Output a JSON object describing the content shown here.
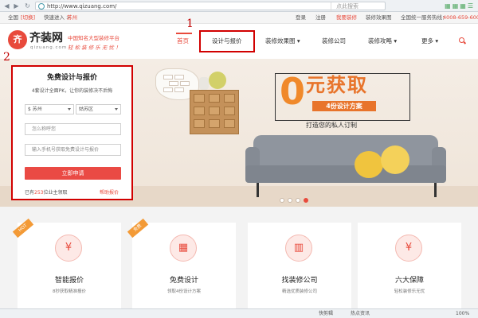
{
  "browser": {
    "url": "http://www.qizuang.com/",
    "search_placeholder": "点此搜索",
    "nav_icons": [
      "back-icon",
      "forward-icon",
      "refresh-icon",
      "home-icon"
    ]
  },
  "topbar": {
    "region": "全国",
    "switch": "[切换]",
    "quick_enter": "快速进入 >",
    "city": "苏州",
    "login": "登录",
    "register": "注册",
    "want_decorate": "我要装修",
    "pricing_link": "装修效果图",
    "hotline_label": "全国统一服务热线：",
    "hotline": "4008-659-600"
  },
  "header": {
    "logo_mark": "齐",
    "logo_name": "齐装网",
    "logo_sub": "qizuang.com",
    "slogan_line1": "中国知名大型装修平台",
    "slogan_line2": "轻 松 装 修 乐 无 忧 ！",
    "nav": {
      "home": "首页",
      "design_quote": "设计与报价",
      "effects": "装修效果图",
      "company": "装修公司",
      "guide": "装修攻略",
      "more": "更多"
    }
  },
  "annotations": {
    "label_1": "1",
    "label_2": "2"
  },
  "hero": {
    "zero": "0",
    "huoqu": "元获取",
    "strip": "4份设计方案",
    "subtitle": "打造您的私人订制"
  },
  "form": {
    "title": "免费设计与报价",
    "desc": "4套设计全面PK，让你的装修决不后悔",
    "city_select": "$ 苏州",
    "district_select": "姑苏区",
    "name_placeholder": "怎么称呼您",
    "phone_placeholder": "输入手机号获取免费设计与报价",
    "apply": "立即申请",
    "count_prefix": "已有",
    "count": "253",
    "count_suffix": "位业主领取",
    "help_link": "帮助报价"
  },
  "cards": [
    {
      "title": "智能报价",
      "desc": "8秒获取精准报价",
      "icon": "calculator-icon",
      "glyph": "¥",
      "tag": "HOT"
    },
    {
      "title": "免费设计",
      "desc": "领取4份设计方案",
      "icon": "blueprint-icon",
      "glyph": "▦",
      "tag": "免费"
    },
    {
      "title": "找装修公司",
      "desc": "精选优质装修公司",
      "icon": "building-icon",
      "glyph": "▥",
      "tag": ""
    },
    {
      "title": "六大保障",
      "desc": "轻松装修乐无忧",
      "icon": "shield-icon",
      "glyph": "¥",
      "tag": ""
    }
  ],
  "statusbar": {
    "item1": "快剪辑",
    "item2": "热点资讯",
    "zoom": "100%"
  },
  "colors": {
    "brand": "#e84a3c",
    "highlight_box": "#d10000",
    "banner_orange": "#f0892b"
  }
}
